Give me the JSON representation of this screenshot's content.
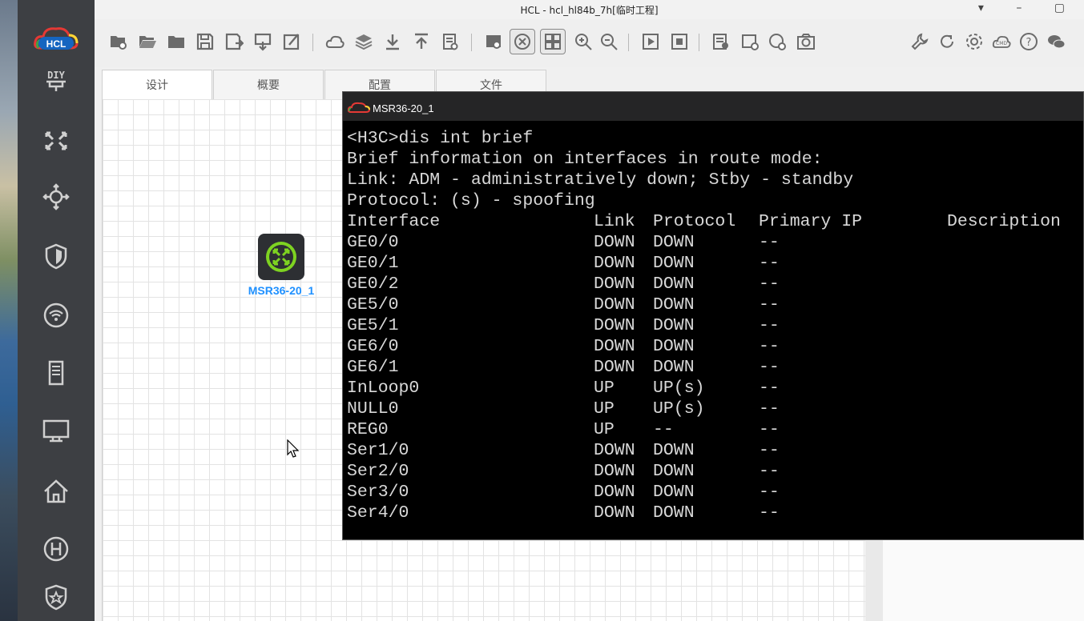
{
  "window": {
    "title": "HCL - hcl_hl84b_7h[临时工程]"
  },
  "tabs": [
    {
      "label": "设计",
      "active": true
    },
    {
      "label": "概要",
      "active": false
    },
    {
      "label": "配置",
      "active": false
    },
    {
      "label": "文件",
      "active": false
    }
  ],
  "device": {
    "label": "MSR36-20_1"
  },
  "terminal": {
    "title": "MSR36-20_1",
    "lines": [
      "<H3C>dis int brief",
      "Brief information on interfaces in route mode:",
      "Link: ADM - administratively down; Stby - standby",
      "Protocol: (s) - spoofing"
    ],
    "columns": [
      "Interface",
      "Link",
      "Protocol",
      "Primary IP",
      "Description"
    ],
    "rows": [
      [
        "GE0/0",
        "DOWN",
        "DOWN",
        "--"
      ],
      [
        "GE0/1",
        "DOWN",
        "DOWN",
        "--"
      ],
      [
        "GE0/2",
        "DOWN",
        "DOWN",
        "--"
      ],
      [
        "GE5/0",
        "DOWN",
        "DOWN",
        "--"
      ],
      [
        "GE5/1",
        "DOWN",
        "DOWN",
        "--"
      ],
      [
        "GE6/0",
        "DOWN",
        "DOWN",
        "--"
      ],
      [
        "GE6/1",
        "DOWN",
        "DOWN",
        "--"
      ],
      [
        "InLoop0",
        "UP",
        "UP(s)",
        "--"
      ],
      [
        "NULL0",
        "UP",
        "UP(s)",
        "--"
      ],
      [
        "REG0",
        "UP",
        "--",
        "--"
      ],
      [
        "Ser1/0",
        "DOWN",
        "DOWN",
        "--"
      ],
      [
        "Ser2/0",
        "DOWN",
        "DOWN",
        "--"
      ],
      [
        "Ser3/0",
        "DOWN",
        "DOWN",
        "--"
      ],
      [
        "Ser4/0",
        "DOWN",
        "DOWN",
        "--"
      ]
    ]
  },
  "sidebar": {
    "logo": "HCL",
    "diy_label": "DIY",
    "icons": [
      "switch-icon",
      "router-icon",
      "firewall-icon",
      "wireless-icon",
      "server-icon",
      "terminal-pc-icon",
      "home-icon",
      "hub-icon",
      "security-icon"
    ]
  },
  "colors": {
    "accent": "#1e90ff",
    "sidebar": "#3d3f43",
    "terminal_bg": "#000000",
    "device_green": "#7ed321"
  }
}
